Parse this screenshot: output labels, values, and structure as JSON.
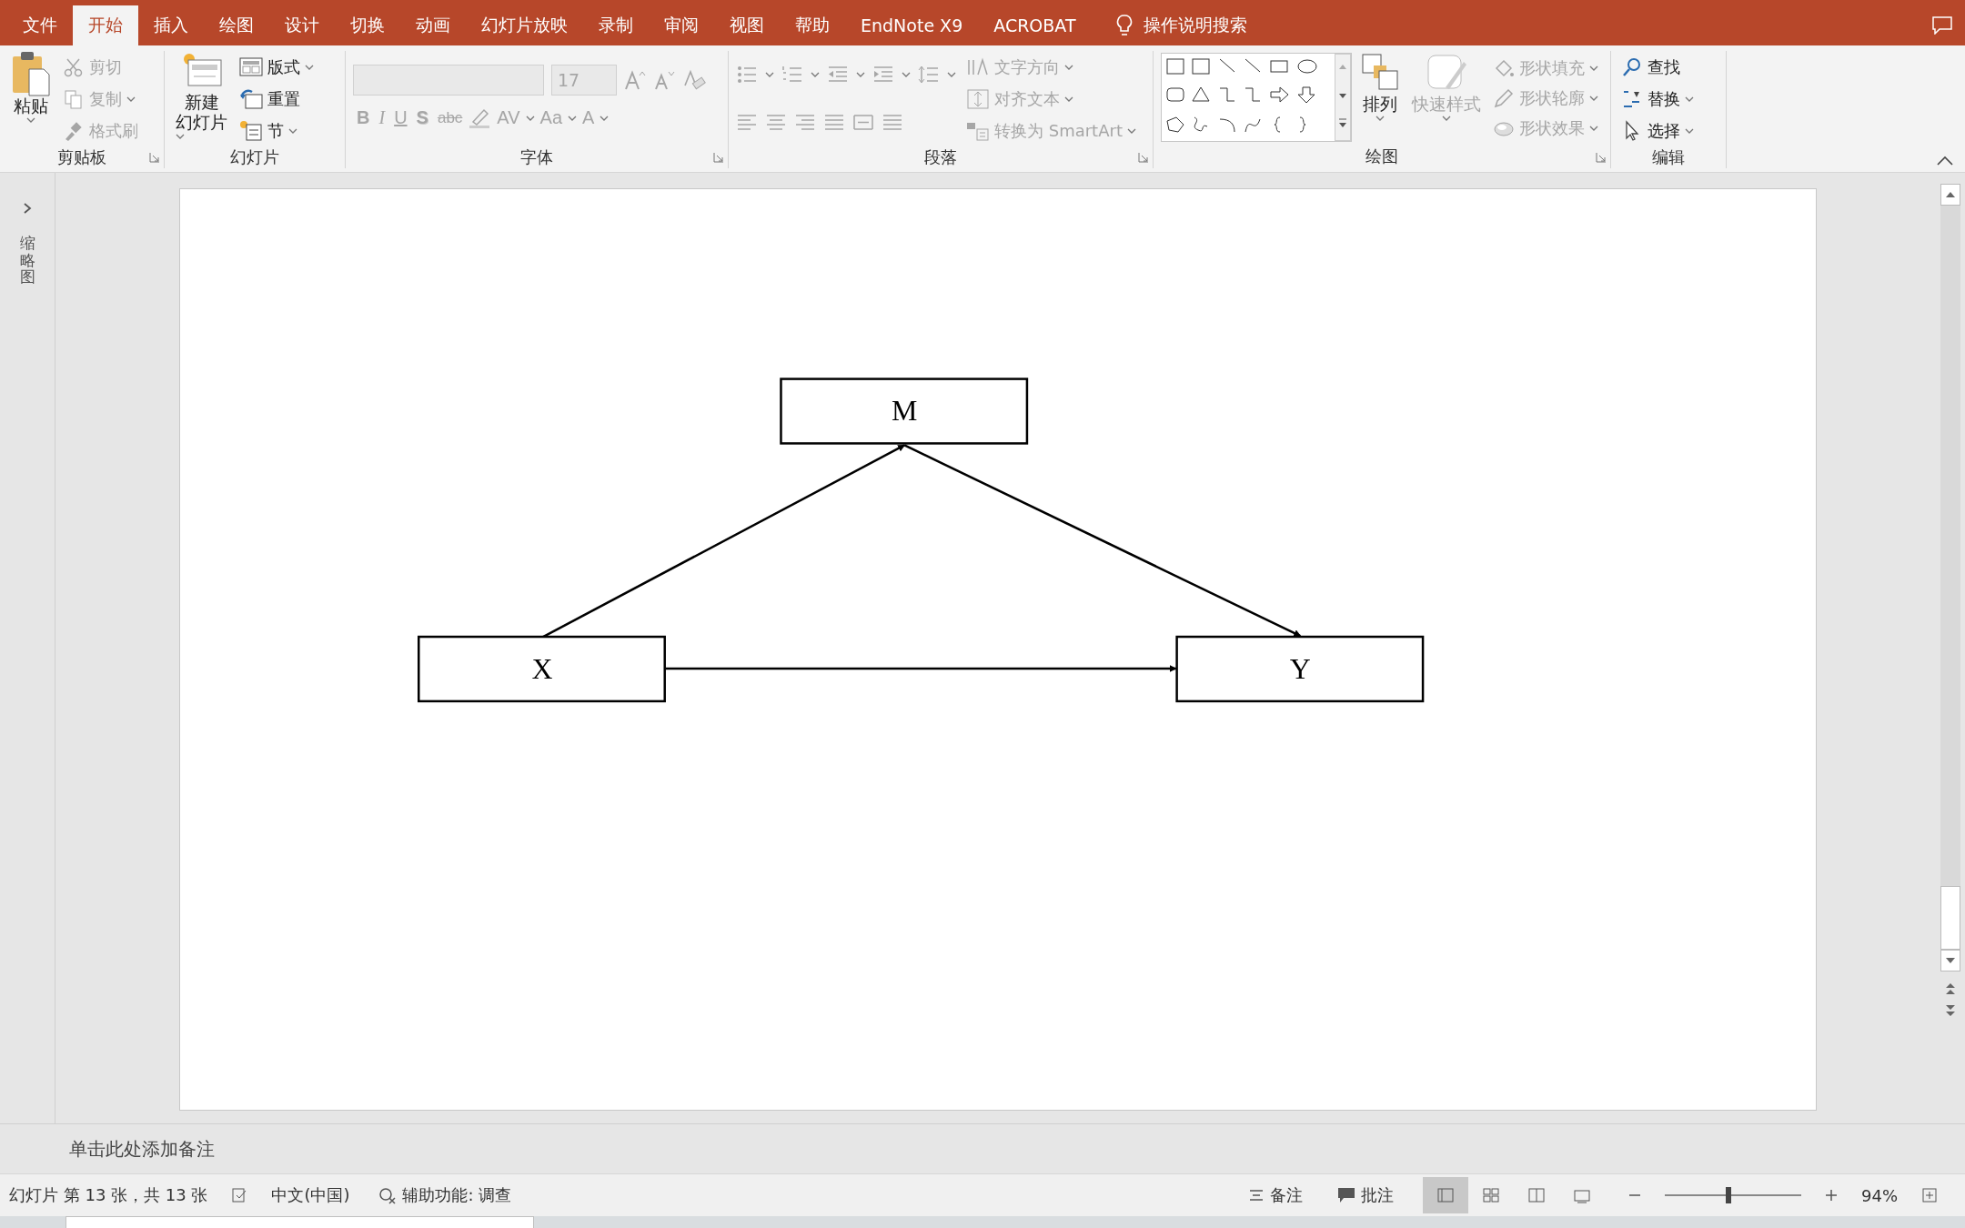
{
  "tabs": [
    {
      "label": "文件",
      "selected": false
    },
    {
      "label": "开始",
      "selected": true
    },
    {
      "label": "插入",
      "selected": false
    },
    {
      "label": "绘图",
      "selected": false
    },
    {
      "label": "设计",
      "selected": false
    },
    {
      "label": "切换",
      "selected": false
    },
    {
      "label": "动画",
      "selected": false
    },
    {
      "label": "幻灯片放映",
      "selected": false
    },
    {
      "label": "录制",
      "selected": false
    },
    {
      "label": "审阅",
      "selected": false
    },
    {
      "label": "视图",
      "selected": false
    },
    {
      "label": "帮助",
      "selected": false
    },
    {
      "label": "EndNote X9",
      "selected": false
    },
    {
      "label": "ACROBAT",
      "selected": false
    }
  ],
  "tell_me": "操作说明搜索",
  "ribbon": {
    "clipboard": {
      "title": "剪贴板",
      "paste": "粘贴",
      "items": [
        {
          "label": "剪切",
          "disabled": true
        },
        {
          "label": "复制",
          "disabled": true
        },
        {
          "label": "格式刷",
          "disabled": true
        }
      ]
    },
    "slides": {
      "title": "幻灯片",
      "new_slide": [
        "新建",
        "幻灯片"
      ],
      "items": [
        {
          "label": "版式",
          "disabled": false
        },
        {
          "label": "重置",
          "disabled": false
        },
        {
          "label": "节",
          "disabled": false
        }
      ]
    },
    "font": {
      "title": "字体",
      "size": "17",
      "disabled": true,
      "format_buttons": [
        "B",
        "I",
        "U",
        "S",
        "abc",
        "AV",
        "Aa",
        "A"
      ]
    },
    "paragraph": {
      "title": "段落",
      "items": [
        {
          "label": "文字方向",
          "disabled": true
        },
        {
          "label": "对齐文本",
          "disabled": true
        },
        {
          "label": "转换为 SmartArt",
          "disabled": true
        }
      ]
    },
    "drawing": {
      "title": "绘图",
      "arrange": "排列",
      "quick_styles": {
        "label": "快速样式",
        "disabled": true
      },
      "items": [
        {
          "label": "形状填充",
          "disabled": true
        },
        {
          "label": "形状轮廓",
          "disabled": true
        },
        {
          "label": "形状效果",
          "disabled": true
        }
      ]
    },
    "editing": {
      "title": "编辑",
      "items": [
        {
          "label": "查找",
          "disabled": false
        },
        {
          "label": "替换",
          "disabled": false
        },
        {
          "label": "选择",
          "disabled": false
        }
      ]
    }
  },
  "thumbnails_pane": {
    "label": "缩略图"
  },
  "slide": {
    "nodes": [
      {
        "label": "M"
      },
      {
        "label": "X"
      },
      {
        "label": "Y"
      }
    ]
  },
  "notes_placeholder": "单击此处添加备注",
  "status_bar": {
    "slide_info": "幻灯片 第 13 张，共 13 张",
    "language": "中文(中国)",
    "accessibility": "辅助功能: 调查",
    "notes": "备注",
    "comments": "批注",
    "views": [
      {
        "selected": true
      },
      {
        "selected": false
      },
      {
        "selected": false
      },
      {
        "selected": false
      }
    ],
    "zoom_slider": {
      "level": 0.47
    },
    "zoom": "94%"
  }
}
